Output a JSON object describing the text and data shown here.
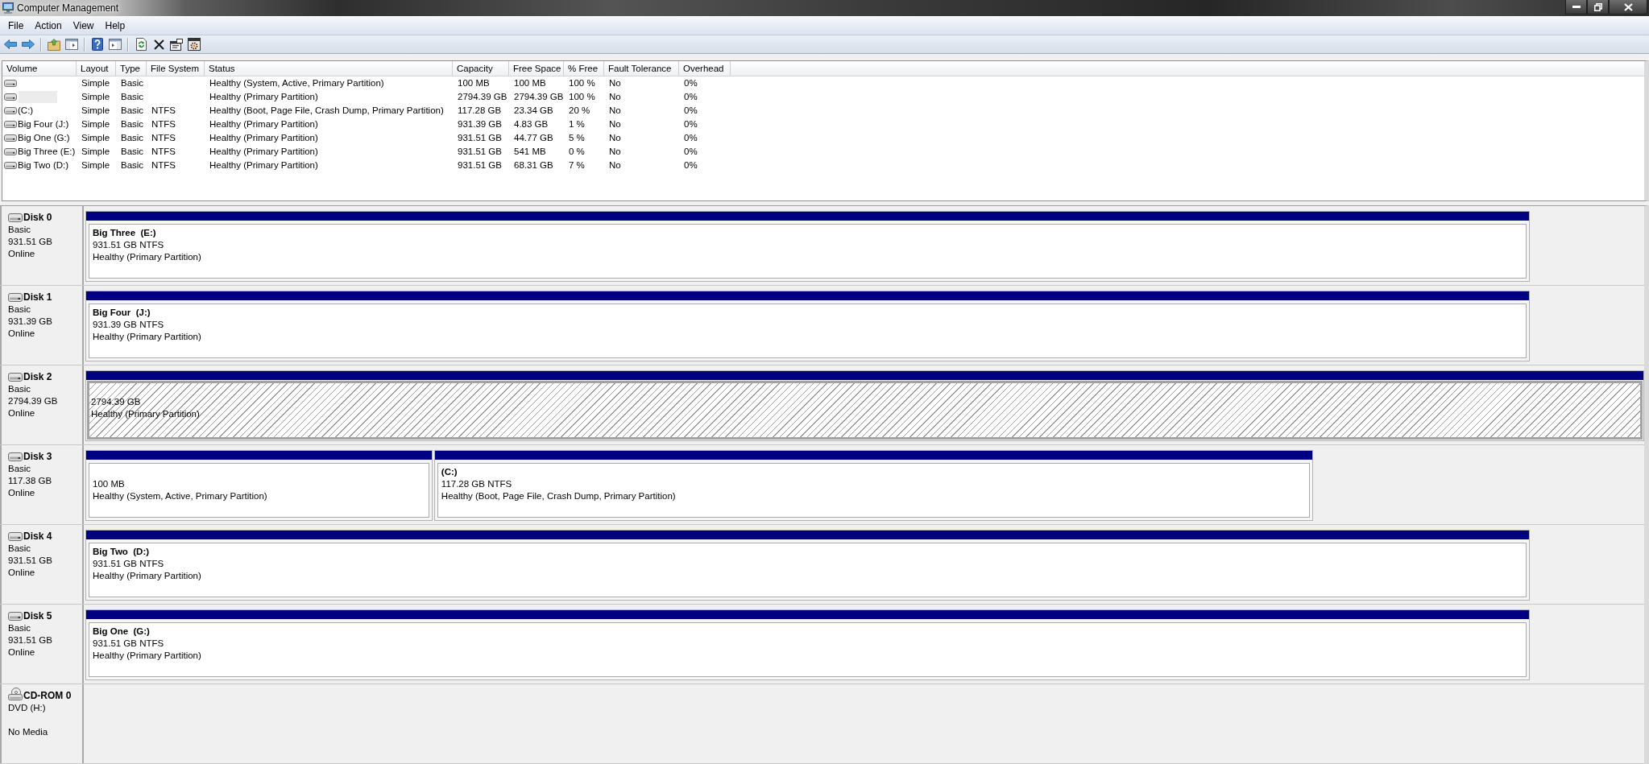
{
  "window": {
    "title": "Computer Management"
  },
  "menu": [
    "File",
    "Action",
    "View",
    "Help"
  ],
  "volume_table": {
    "columns": [
      "Volume",
      "Layout",
      "Type",
      "File System",
      "Status",
      "Capacity",
      "Free Space",
      "% Free",
      "Fault Tolerance",
      "Overhead"
    ],
    "rows": [
      {
        "layout": "Simple",
        "type": "Basic",
        "status": "Healthy (System, Active, Primary Partition)",
        "capacity": "100 MB",
        "free_space": "100 MB",
        "percent_free": "100 %",
        "fault_tolerance": "No",
        "overhead": "0%",
        "masked": false
      },
      {
        "layout": "Simple",
        "type": "Basic",
        "status": "Healthy (Primary Partition)",
        "capacity": "2794.39 GB",
        "free_space": "2794.39 GB",
        "percent_free": "100 %",
        "fault_tolerance": "No",
        "overhead": "0%",
        "masked": true
      },
      {
        "volume": "(C:)",
        "layout": "Simple",
        "type": "Basic",
        "file_system": "NTFS",
        "status": "Healthy (Boot, Page File, Crash Dump, Primary Partition)",
        "capacity": "117.28 GB",
        "free_space": "23.34 GB",
        "percent_free": "20 %",
        "fault_tolerance": "No",
        "overhead": "0%",
        "masked": false
      },
      {
        "volume": "Big Four (J:)",
        "layout": "Simple",
        "type": "Basic",
        "file_system": "NTFS",
        "status": "Healthy (Primary Partition)",
        "capacity": "931.39 GB",
        "free_space": "4.83 GB",
        "percent_free": "1 %",
        "fault_tolerance": "No",
        "overhead": "0%",
        "masked": false
      },
      {
        "volume": "Big One (G:)",
        "layout": "Simple",
        "type": "Basic",
        "file_system": "NTFS",
        "status": "Healthy (Primary Partition)",
        "capacity": "931.51 GB",
        "free_space": "44.77 GB",
        "percent_free": "5 %",
        "fault_tolerance": "No",
        "overhead": "0%",
        "masked": false
      },
      {
        "volume": "Big Three (E:)",
        "layout": "Simple",
        "type": "Basic",
        "file_system": "NTFS",
        "status": "Healthy (Primary Partition)",
        "capacity": "931.51 GB",
        "free_space": "541 MB",
        "percent_free": "0 %",
        "fault_tolerance": "No",
        "overhead": "0%",
        "masked": false
      },
      {
        "volume": "Big Two (D:)",
        "layout": "Simple",
        "type": "Basic",
        "file_system": "NTFS",
        "status": "Healthy (Primary Partition)",
        "capacity": "931.51 GB",
        "free_space": "68.31 GB",
        "percent_free": "7 %",
        "fault_tolerance": "No",
        "overhead": "0%",
        "masked": false
      }
    ]
  },
  "disks": [
    {
      "kind": "disk",
      "name": "Disk 0",
      "type": "Basic",
      "size": "931.51 GB",
      "status": "Online",
      "partitions": [
        {
          "name": "Big Three  (E:)",
          "size": "931.51 GB NTFS",
          "status": "Healthy (Primary Partition)",
          "selected": false
        }
      ]
    },
    {
      "kind": "disk",
      "name": "Disk 1",
      "type": "Basic",
      "size": "931.39 GB",
      "status": "Online",
      "partitions": [
        {
          "name": "Big Four  (J:)",
          "size": "931.39 GB NTFS",
          "status": "Healthy (Primary Partition)",
          "selected": false
        }
      ]
    },
    {
      "kind": "disk",
      "name": "Disk 2",
      "type": "Basic",
      "size": "2794.39 GB",
      "status": "Online",
      "partitions": [
        {
          "size": "2794.39 GB",
          "status": "Healthy (Primary Partition)",
          "selected": true
        }
      ]
    },
    {
      "kind": "disk",
      "name": "Disk 3",
      "type": "Basic",
      "size": "117.38 GB",
      "status": "Online",
      "partitions": [
        {
          "size": "100 MB",
          "status": "Healthy (System, Active, Primary Partition)",
          "selected": false
        },
        {
          "name": "(C:)",
          "size": "117.28 GB NTFS",
          "status": "Healthy (Boot, Page File, Crash Dump, Primary Partition)",
          "selected": false
        }
      ]
    },
    {
      "kind": "disk",
      "name": "Disk 4",
      "type": "Basic",
      "size": "931.51 GB",
      "status": "Online",
      "partitions": [
        {
          "name": "Big Two  (D:)",
          "size": "931.51 GB NTFS",
          "status": "Healthy (Primary Partition)",
          "selected": false
        }
      ]
    },
    {
      "kind": "disk",
      "name": "Disk 5",
      "type": "Basic",
      "size": "931.51 GB",
      "status": "Online",
      "partitions": [
        {
          "name": "Big One  (G:)",
          "size": "931.51 GB NTFS",
          "status": "Healthy (Primary Partition)",
          "selected": false
        }
      ]
    },
    {
      "kind": "cdrom",
      "name": "CD-ROM 0",
      "type": "DVD (H:)",
      "status": "No Media"
    }
  ]
}
